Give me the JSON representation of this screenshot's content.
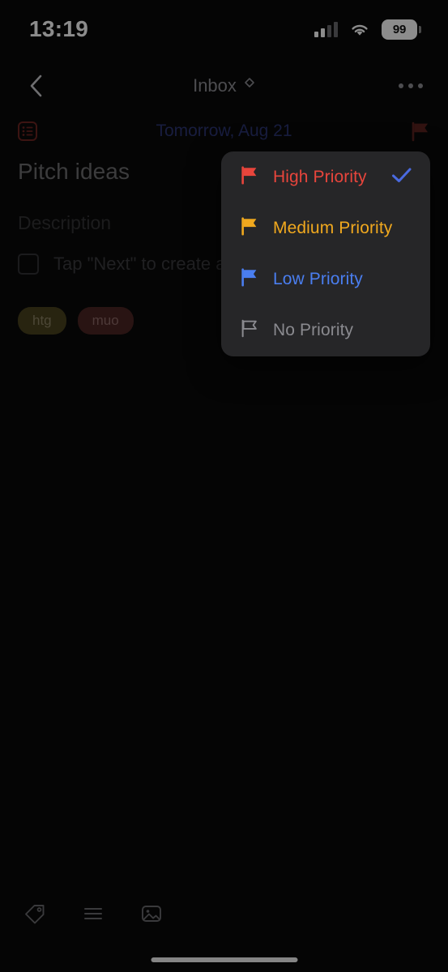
{
  "status_bar": {
    "time": "13:19",
    "battery_level": "99",
    "signal_icon": "cellular-signal-icon",
    "wifi_icon": "wifi-icon",
    "battery_icon": "battery-icon"
  },
  "nav": {
    "back_icon": "chevron-left-icon",
    "title": "Inbox",
    "title_chevron_icon": "chevron-updown-icon",
    "more_label": "•••",
    "more_icon": "ellipsis-icon"
  },
  "meta": {
    "list_icon": "list-icon",
    "date": "Tomorrow, Aug 21",
    "flag_icon": "flag-filled-icon",
    "date_color": "#2c3573",
    "flag_color": "#5c2420"
  },
  "task": {
    "title": "Pitch ideas",
    "description_placeholder": "Description",
    "subtask": {
      "checkbox_icon": "checkbox-empty-icon",
      "text": "Tap \"Next\" to create a"
    },
    "tags": [
      {
        "label": "htg",
        "bg": "#4a421e",
        "fg": "#8b8163"
      },
      {
        "label": "muo",
        "bg": "#4b2523",
        "fg": "#8d6866"
      }
    ]
  },
  "priority_menu": {
    "items": [
      {
        "label": "High Priority",
        "color": "#e8453c",
        "flag": "flag-filled-icon",
        "selected": true
      },
      {
        "label": "Medium Priority",
        "color": "#f0a81e",
        "flag": "flag-filled-icon",
        "selected": false
      },
      {
        "label": "Low Priority",
        "color": "#4a7ef0",
        "flag": "flag-filled-icon",
        "selected": false
      },
      {
        "label": "No Priority",
        "color": "#8a8a8f",
        "flag": "flag-outline-icon",
        "selected": false
      }
    ],
    "check_icon": "checkmark-icon",
    "check_color": "#4a6ae0",
    "background": "#262628"
  },
  "toolbar": {
    "items": [
      {
        "icon": "tag-icon"
      },
      {
        "icon": "list-lines-icon"
      },
      {
        "icon": "image-icon"
      }
    ]
  },
  "home_indicator": "home-indicator"
}
